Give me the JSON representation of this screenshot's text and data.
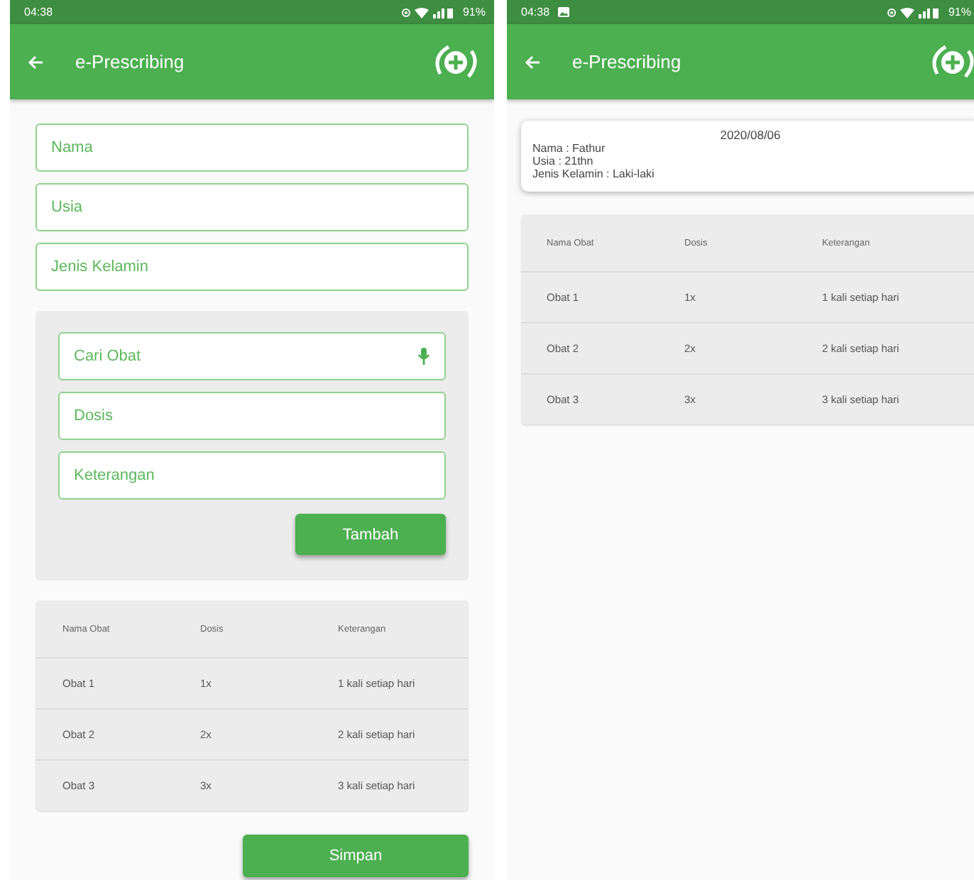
{
  "screens": [
    {
      "status_bar": {
        "time": "04:38",
        "battery": "91%",
        "photo_notice": false
      },
      "app_bar": {
        "title": "e-Prescribing"
      },
      "patient_fields": [
        {
          "placeholder": "Nama"
        },
        {
          "placeholder": "Usia"
        },
        {
          "placeholder": "Jenis Kelamin"
        }
      ],
      "medicine_panel": {
        "fields": [
          {
            "placeholder": "Cari Obat",
            "kind": "voice"
          },
          {
            "placeholder": "Dosis",
            "kind": "plain"
          },
          {
            "placeholder": "Keterangan",
            "kind": "plain"
          }
        ],
        "button": "Tambah"
      },
      "table": {
        "columns": [
          "Nama Obat",
          "Dosis",
          "Keterangan"
        ],
        "rows": [
          [
            "Obat 1",
            "1x",
            "1 kali setiap hari"
          ],
          [
            "Obat 2",
            "2x",
            "2 kali setiap hari"
          ],
          [
            "Obat 3",
            "3x",
            "3 kali setiap hari"
          ]
        ]
      },
      "button": "Simpan"
    },
    {
      "status_bar": {
        "time": "04:38",
        "battery": "91%",
        "photo_notice": true
      },
      "app_bar": {
        "title": "e-Prescribing"
      },
      "summary": {
        "date": "2020/08/06",
        "lines": [
          "Nama : Fathur",
          "Usia : 21thn",
          "Jenis Kelamin : Laki-laki"
        ]
      },
      "table": {
        "columns": [
          "Nama Obat",
          "Dosis",
          "Keterangan"
        ],
        "rows": [
          [
            "Obat 1",
            "1x",
            "1 kali setiap hari"
          ],
          [
            "Obat 2",
            "2x",
            "2 kali setiap hari"
          ],
          [
            "Obat 3",
            "3x",
            "3 kali setiap hari"
          ]
        ]
      }
    }
  ]
}
